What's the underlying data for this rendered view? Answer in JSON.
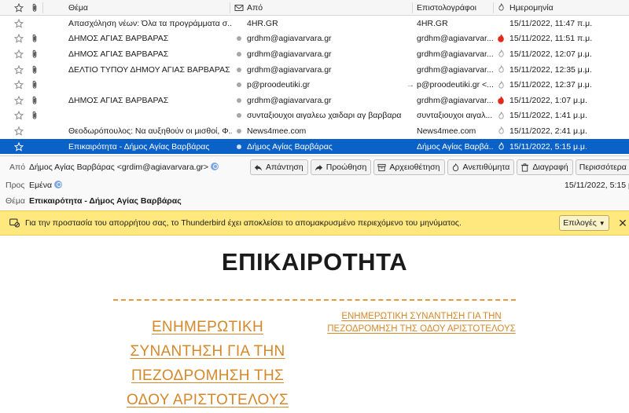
{
  "columns": {
    "subject": "Θέμα",
    "from": "Από",
    "correspondents": "Επιστολογράφοι",
    "date": "Ημερομηνία"
  },
  "messages": [
    {
      "attach": false,
      "read": false,
      "subject": "Απασχόληση νέων: Όλα τα προγράμματα σ...",
      "from": "4HR.GR",
      "correspondents": "4HR.GR",
      "junk": "none",
      "date": "15/11/2022, 11:47 π.μ."
    },
    {
      "attach": true,
      "read": true,
      "subject": "ΔΗΜΟΣ ΑΓΙΑΣ ΒΑΡΒΑΡΑΣ",
      "from": "grdhm@agiavarvara.gr",
      "correspondents": "grdhm@agiavarvar...",
      "junk": "flame",
      "date": "15/11/2022, 11:51 π.μ."
    },
    {
      "attach": true,
      "read": true,
      "subject": "ΔΗΜΟΣ ΑΓΙΑΣ ΒΑΡΒΑΡΑΣ",
      "from": "grdhm@agiavarvara.gr",
      "correspondents": "grdhm@agiavarvar...",
      "junk": "icon",
      "date": "15/11/2022, 12:07 μ.μ."
    },
    {
      "attach": true,
      "read": true,
      "subject": "ΔΕΛΤΙΟ ΤΥΠΟΥ ΔΗΜΟΥ ΑΓΙΑΣ ΒΑΡΒΑΡΑΣ",
      "from": "grdhm@agiavarvara.gr",
      "correspondents": "grdhm@agiavarvar...",
      "junk": "icon",
      "date": "15/11/2022, 12:35 μ.μ."
    },
    {
      "attach": true,
      "read": true,
      "subject": "",
      "from": "p@proodeutiki.gr",
      "correspondents": "p@proodeutiki.gr <...",
      "arrow": "→",
      "junk": "icon",
      "date": "15/11/2022, 12:37 μ.μ."
    },
    {
      "attach": true,
      "read": true,
      "subject": "ΔΗΜΟΣ ΑΓΙΑΣ ΒΑΡΒΑΡΑΣ",
      "from": "grdhm@agiavarvara.gr",
      "correspondents": "grdhm@agiavarvar...",
      "junk": "flame",
      "date": "15/11/2022, 1:07 μ.μ."
    },
    {
      "attach": true,
      "read": true,
      "subject": "",
      "from": "συνταξιουχοι αιγαλεω χαιδαρι αγ βαρβαρα",
      "correspondents": "συνταξιουχοι αιγαλ...",
      "junk": "icon",
      "date": "15/11/2022, 1:41 μ.μ."
    },
    {
      "attach": false,
      "read": true,
      "subject": "Θεοδωρόπουλος: Να αυξηθούν οι μισθοί, Φ...",
      "from": "News4mee.com",
      "correspondents": "News4mee.com",
      "junk": "icon",
      "date": "15/11/2022, 2:41 μ.μ."
    },
    {
      "attach": false,
      "read": true,
      "subject": "Επικαιρότητα - Δήμος Αγίας Βαρβάρας",
      "from": "Δήμος Αγίας Βαρβάρας",
      "correspondents": "Δήμος Αγίας Βαρβά...",
      "junk": "icon",
      "date": "15/11/2022, 5:15 μ.μ.",
      "selected": true
    }
  ],
  "header": {
    "from_label": "Από",
    "from_value": "Δήμος Αγίας Βαρβάρας <grdim@agiavarvara.gr>",
    "to_label": "Προς",
    "to_value": "Εμένα",
    "subject_label": "Θέμα",
    "subject_value": "Επικαιρότητα - Δήμος Αγίας Βαρβάρας",
    "date_value": "15/11/2022, 5:15 μ.μ.",
    "buttons": {
      "reply": "Απάντηση",
      "forward": "Προώθηση",
      "archive": "Αρχειοθέτηση",
      "junk": "Ανεπιθύμητα",
      "delete": "Διαγραφή",
      "more": "Περισσότερα"
    }
  },
  "notice": {
    "text": "Για την προστασία του απορρήτου σας, το Thunderbird έχει αποκλείσει το απομακρυσμένο περιεχόμενο του μηνύματος.",
    "options": "Επιλογές",
    "close": "✕"
  },
  "mail": {
    "title": "ΕΠΙΚΑΙΡΟΤΗΤΑ",
    "link_big_lines": [
      "ΕΝΗΜΕΡΩΤΙΚΗ",
      "ΣΥΝΑΝΤΗΣΗ ΓΙΑ ΤΗΝ",
      "ΠΕΖΟΔΡΟΜΗΣΗ ΤΗΣ",
      "ΟΔΟΥ ΑΡΙΣΤΟΤΕΛΟΥΣ"
    ],
    "link_small_lines": [
      "ΕΝΗΜΕΡΩΤΙΚΗ ΣΥΝΑΝΤΗΣΗ ΓΙΑ ΤΗΝ",
      "ΠΕΖΟΔΡΟΜΗΣΗ ΤΗΣ ΟΔΟΥ ΑΡΙΣΤΟΤΕΛΟΥΣ"
    ]
  },
  "colors": {
    "selection": "#0a62c9",
    "notice": "#ffe97e",
    "link": "#d4882a",
    "flame": "#e02a1c"
  }
}
